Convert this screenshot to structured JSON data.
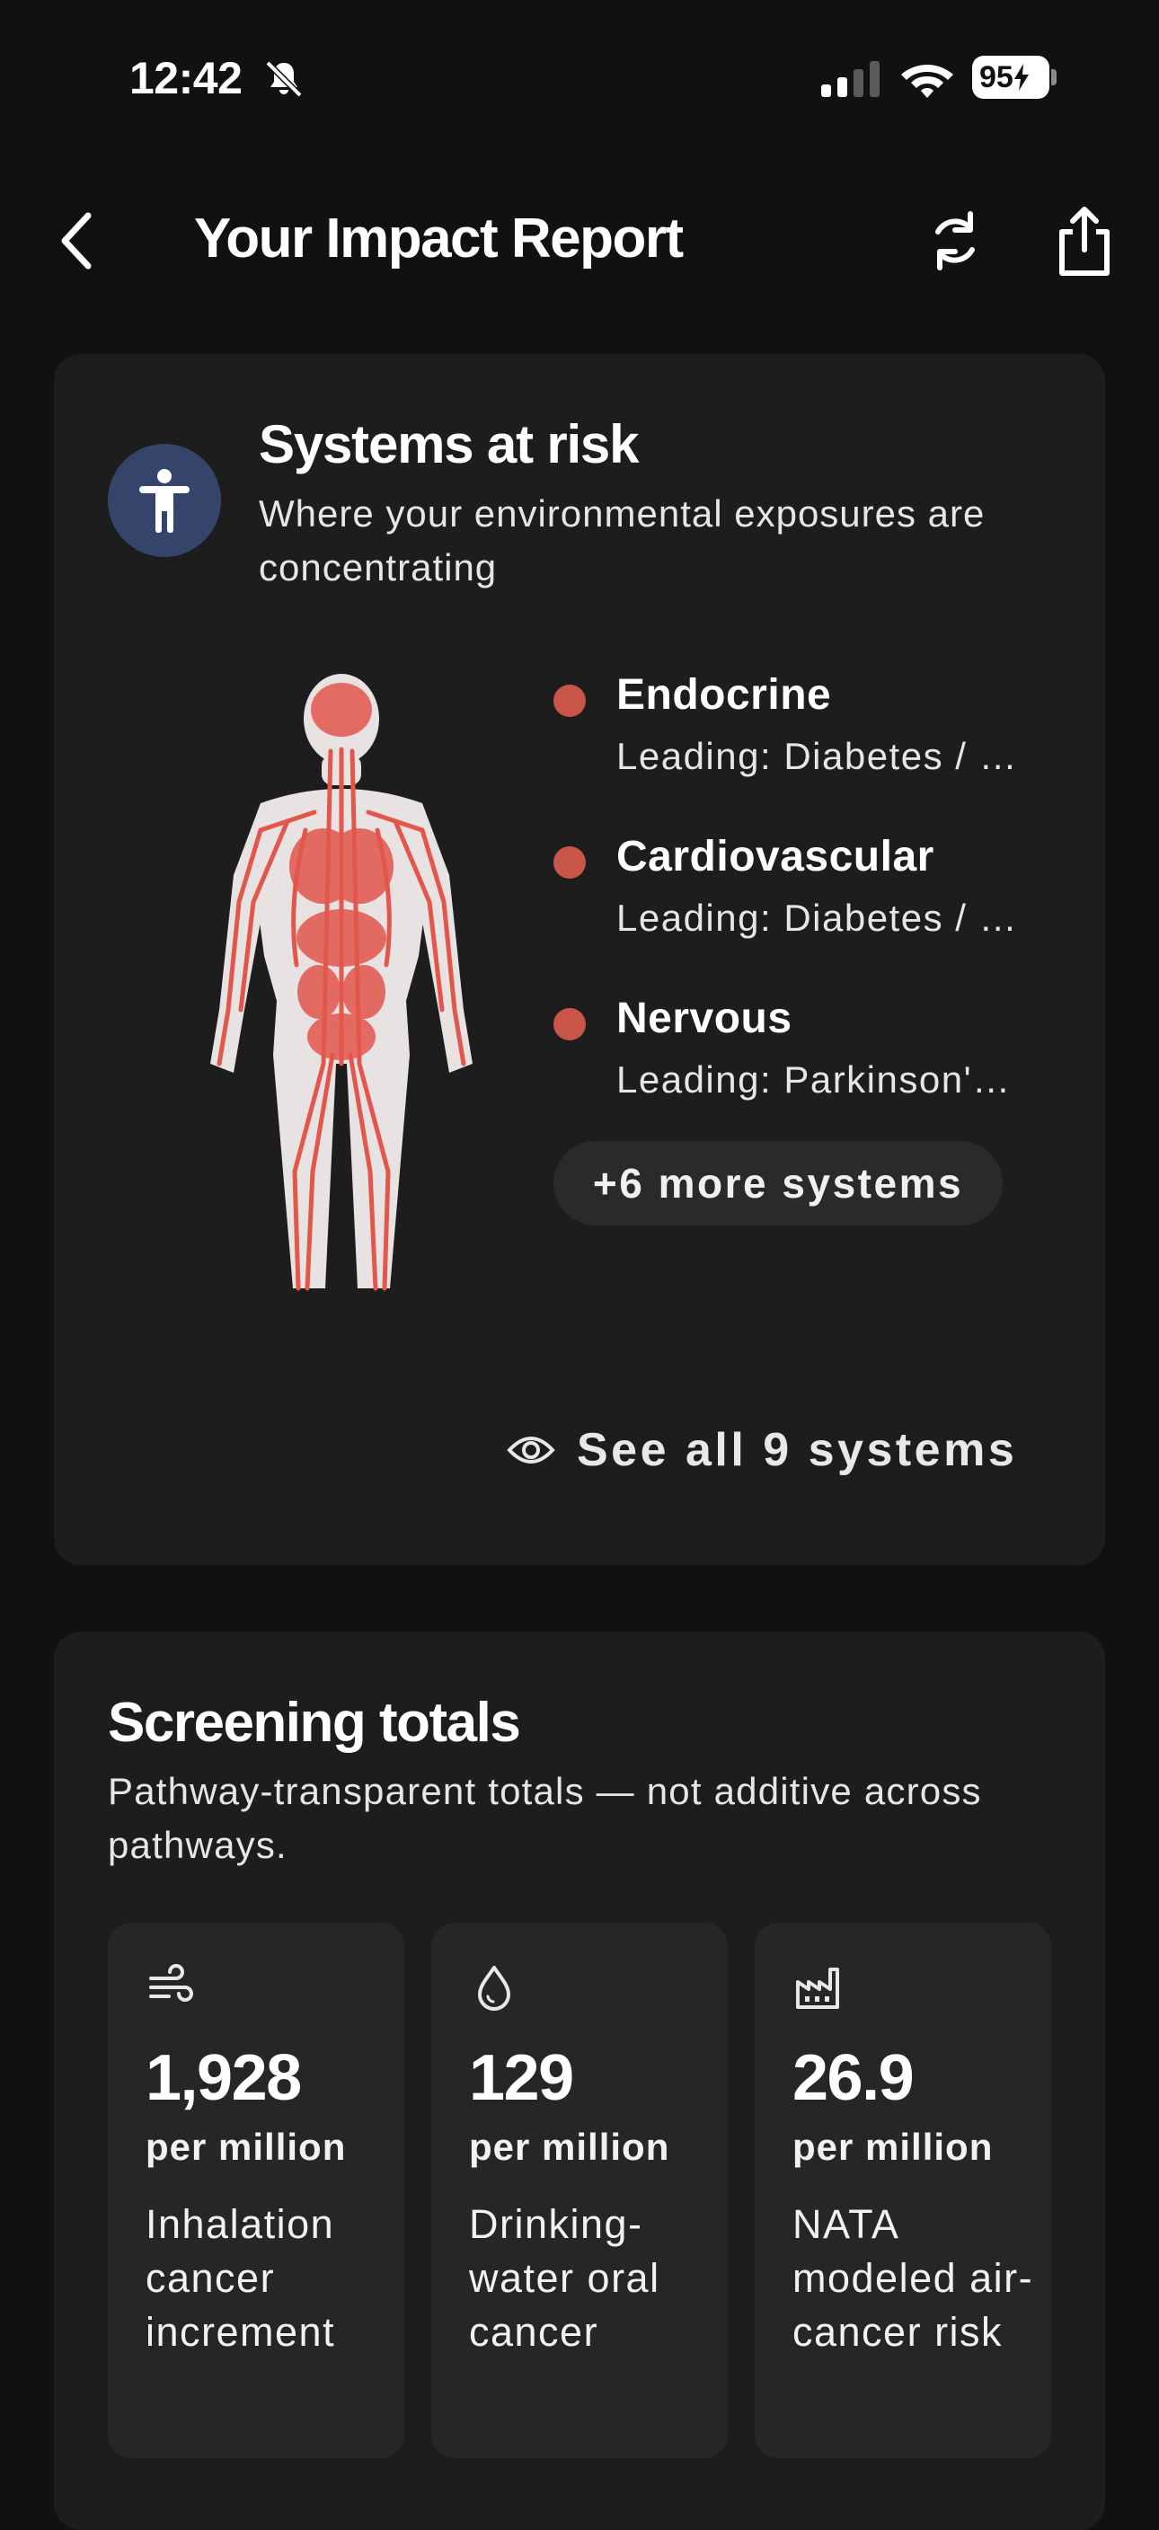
{
  "status_bar": {
    "time": "12:42",
    "battery": "95"
  },
  "nav": {
    "title": "Your Impact Report"
  },
  "systems_card": {
    "title": "Systems at risk",
    "subtitle": "Where your environmental exposures are concentrating",
    "dot_color": "#c85548",
    "items": [
      {
        "name": "Endocrine",
        "leading": "Leading: Diabetes / …"
      },
      {
        "name": "Cardiovascular",
        "leading": "Leading: Diabetes / …"
      },
      {
        "name": "Nervous",
        "leading": "Leading: Parkinson'…"
      }
    ],
    "more_label": "+6 more systems",
    "see_all_label": "See all 9 systems"
  },
  "totals_card": {
    "title": "Screening totals",
    "subtitle": "Pathway-transparent totals — not additive across pathways.",
    "metrics": [
      {
        "icon": "wind-icon",
        "value": "1,928",
        "unit": "per million",
        "label": "Inhalation cancer increment"
      },
      {
        "icon": "water-drop-icon",
        "value": "129",
        "unit": "per million",
        "label": "Drinking-water oral cancer"
      },
      {
        "icon": "factory-icon",
        "value": "26.9",
        "unit": "per million",
        "label": "NATA modeled air-cancer risk"
      }
    ]
  },
  "colors": {
    "background": "#111111",
    "card": "#1d1d1d",
    "badge": "#34446a",
    "accent_red": "#c85548"
  }
}
